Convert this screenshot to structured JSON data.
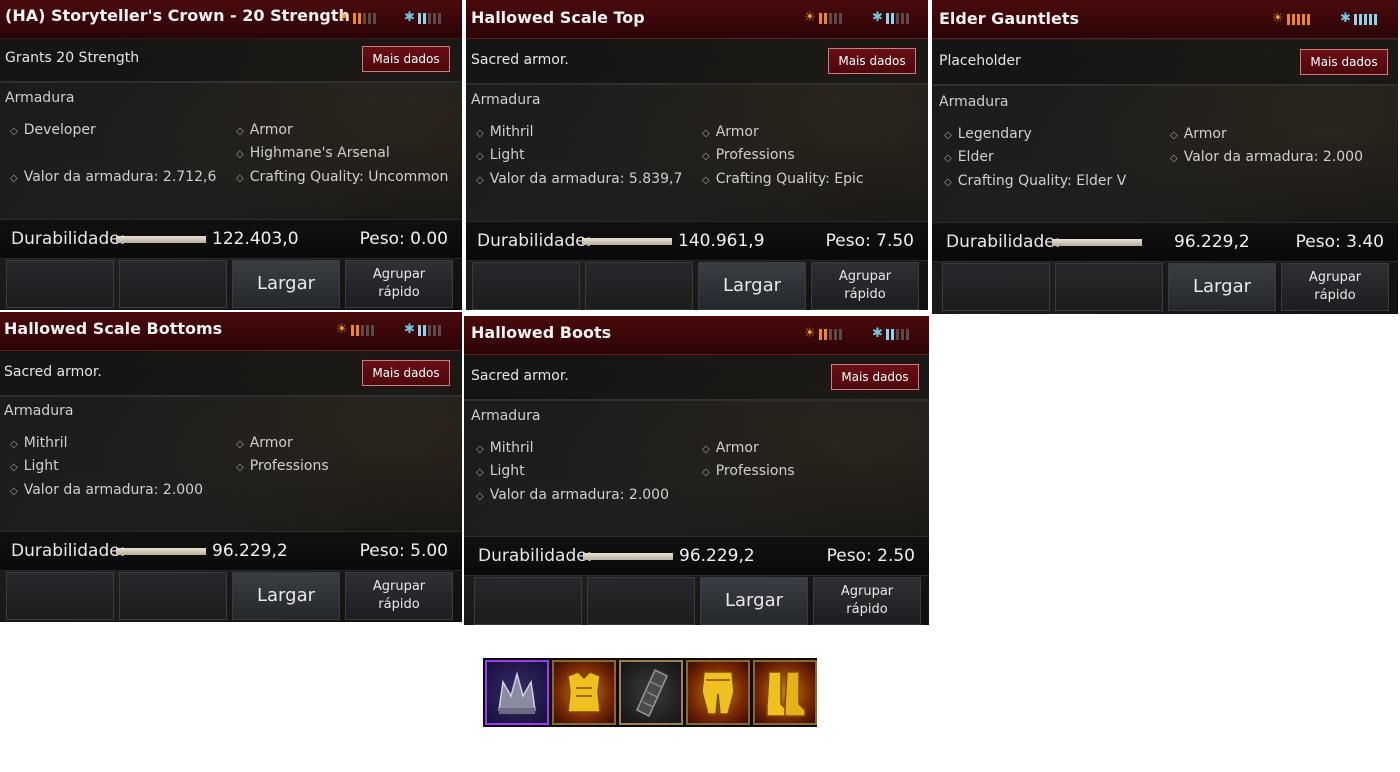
{
  "cards": [
    {
      "title": "(HA) Storyteller's Crown - 20 Strength",
      "desc": "Grants 20 Strength",
      "mais": "Mais dados",
      "category": "Armadura",
      "left_props": [
        "Developer",
        "Valor da armadura: 2.712,6"
      ],
      "right_props": [
        "Armor",
        "Highmane's Arsenal",
        "Crafting Quality: Uncommon"
      ],
      "durability_label": "Durabilidade:",
      "durability_value": "122.403,0",
      "durability_fraction": 1.0,
      "weight": "Peso:  0.00",
      "buttons": [
        "",
        "",
        "Largar",
        "Agrupar rápido"
      ],
      "sun_rank": 2,
      "ice_rank": 2
    },
    {
      "title": "Hallowed Scale Top",
      "desc": "Sacred armor.",
      "mais": "Mais dados",
      "category": "Armadura",
      "left_props": [
        "Mithril",
        "Light",
        "Valor da armadura: 5.839,7"
      ],
      "right_props": [
        "Armor",
        "Professions",
        "Crafting Quality: Epic"
      ],
      "durability_label": "Durabilidade:",
      "durability_value": "140.961,9",
      "durability_fraction": 1.0,
      "weight": "Peso:  7.50",
      "buttons": [
        "",
        "",
        "Largar",
        "Agrupar rápido"
      ],
      "sun_rank": 2,
      "ice_rank": 2
    },
    {
      "title": "Elder Gauntlets",
      "desc": "Placeholder",
      "mais": "Mais dados",
      "category": "Armadura",
      "left_props": [
        "Legendary",
        "Elder",
        "Crafting Quality: Elder V"
      ],
      "right_props": [
        "Armor",
        "Valor da armadura: 2.000"
      ],
      "durability_label": "Durabilidade:",
      "durability_value": "96.229,2",
      "durability_fraction": 1.0,
      "weight": "Peso:  3.40",
      "buttons": [
        "",
        "",
        "Largar",
        "Agrupar rápido"
      ],
      "sun_rank": 5,
      "ice_rank": 5
    },
    {
      "title": "Hallowed Scale Bottoms",
      "desc": "Sacred armor.",
      "mais": "Mais dados",
      "category": "Armadura",
      "left_props": [
        "Mithril",
        "Light",
        "Valor da armadura: 2.000"
      ],
      "right_props": [
        "Armor",
        "Professions"
      ],
      "durability_label": "Durabilidade:",
      "durability_value": "96.229,2",
      "durability_fraction": 1.0,
      "weight": "Peso:  5.00",
      "buttons": [
        "",
        "",
        "Largar",
        "Agrupar rápido"
      ],
      "sun_rank": 2,
      "ice_rank": 2
    },
    {
      "title": "Hallowed Boots",
      "desc": "Sacred armor.",
      "mais": "Mais dados",
      "category": "Armadura",
      "left_props": [
        "Mithril",
        "Light",
        "Valor da armadura: 2.000"
      ],
      "right_props": [
        "Armor",
        "Professions"
      ],
      "durability_label": "Durabilidade:",
      "durability_value": "96.229,2",
      "durability_fraction": 1.0,
      "weight": "Peso:  2.50",
      "buttons": [
        "",
        "",
        "Largar",
        "Agrupar rápido"
      ],
      "sun_rank": 2,
      "ice_rank": 2
    }
  ],
  "tray": [
    {
      "icon": "crown-icon",
      "rarity_color": "#9a3cf0"
    },
    {
      "icon": "chest-armor-icon",
      "rarity_color": "#c08010"
    },
    {
      "icon": "gauntlet-icon",
      "rarity_color": "#a08050"
    },
    {
      "icon": "leg-armor-icon",
      "rarity_color": "#c08010"
    },
    {
      "icon": "boots-icon",
      "rarity_color": "#c08010"
    }
  ]
}
